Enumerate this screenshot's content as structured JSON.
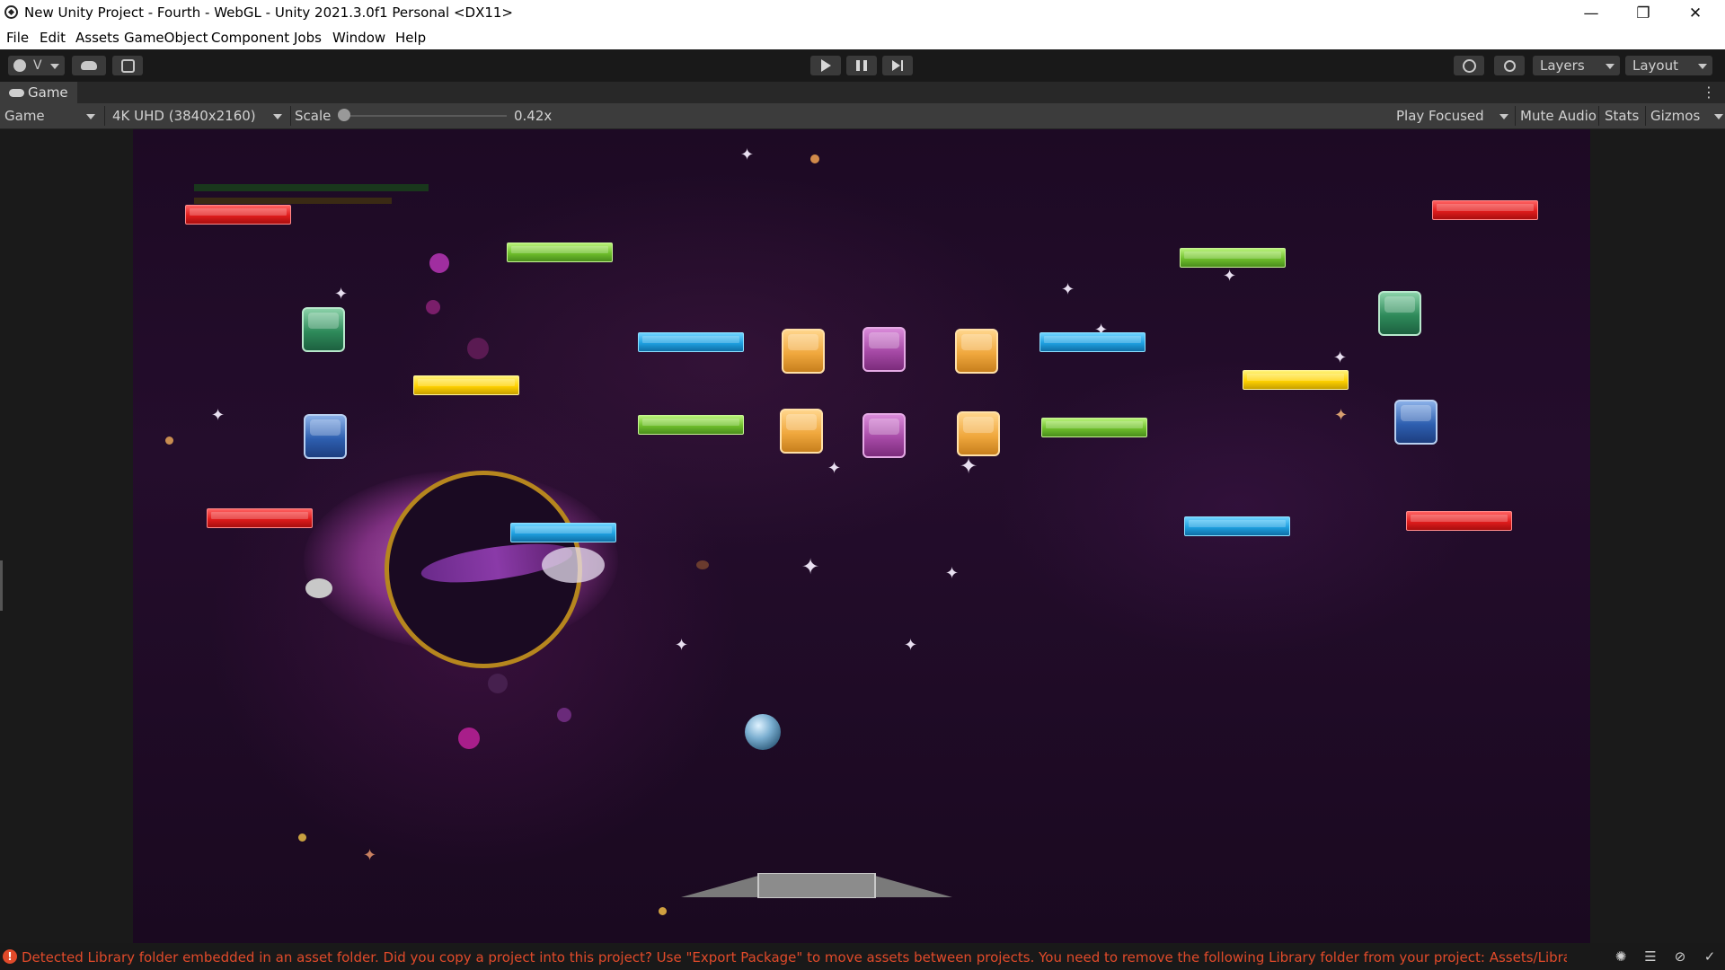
{
  "window": {
    "title": "New Unity Project - Fourth - WebGL - Unity 2021.3.0f1 Personal <DX11>",
    "minimize_icon": "minimize-icon",
    "maximize_icon": "restore-icon",
    "close_icon": "close-icon"
  },
  "menu": [
    "File",
    "Edit",
    "Assets",
    "GameObject",
    "Component",
    "Jobs",
    "Window",
    "Help"
  ],
  "toolbar": {
    "account_label": "V",
    "cloud_icon": "cloud-icon",
    "collab_icon": "collab-icon",
    "play_icon": "play-icon",
    "pause_icon": "pause-icon",
    "step_icon": "step-icon",
    "history_icon": "history-icon",
    "search_icon": "search-icon",
    "layers_label": "Layers",
    "layout_label": "Layout"
  },
  "tab": {
    "label": "Game",
    "icon": "gamepad-icon",
    "more_icon": "kebab-menu-icon"
  },
  "game_view": {
    "display": "Game",
    "resolution": "4K UHD (3840x2160)",
    "scale_label": "Scale",
    "scale_value": "0.42x",
    "scale_fraction": 0.0,
    "play_mode": "Play Focused",
    "mute": "Mute Audio",
    "stats": "Stats",
    "gizmos": "Gizmos"
  },
  "status": {
    "message": "Detected Library folder embedded in an asset folder. Did you copy a project into this project? Use \"Export Package\" to move assets between projects. You need to remove the following Library folder from your project: Assets/Library. Until the",
    "color": "#e04a2a",
    "icons": [
      "bug-icon",
      "layers-stack-icon",
      "network-off-icon",
      "check-circle-icon"
    ]
  },
  "game": {
    "background": "#1d0a24",
    "brick_colors": {
      "red": "#e01c1c",
      "green": "#6fbf2c",
      "blue": "#1ea0e0",
      "yellow": "#ffd200",
      "orange": "#f0a83e",
      "purple": "#a64aa6",
      "teal": "#2e8a5a",
      "navy": "#2e5fb0"
    },
    "ball": "ball",
    "paddle": "paddle"
  }
}
